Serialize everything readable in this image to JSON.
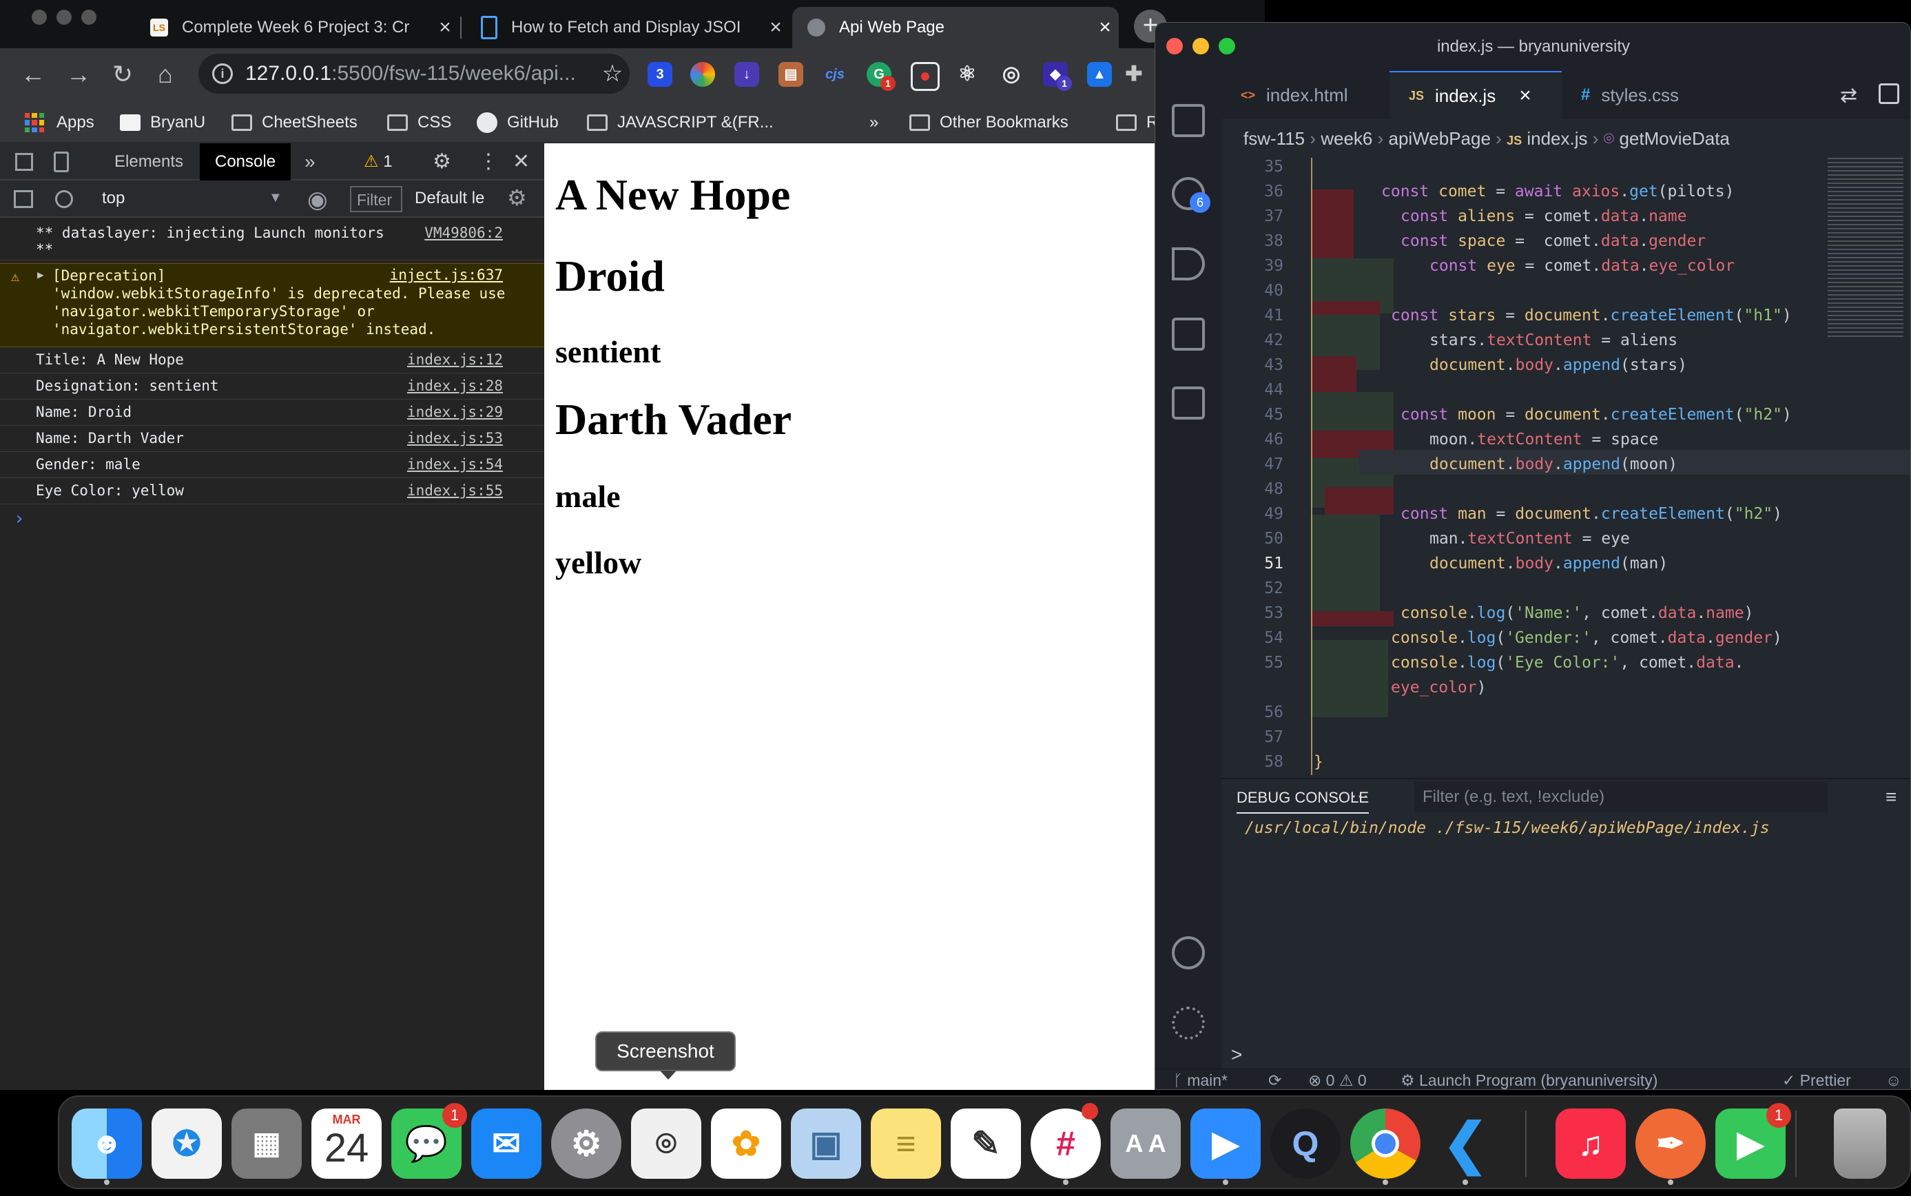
{
  "chrome": {
    "tabs": [
      {
        "title": "Complete Week 6 Project 3: Cr",
        "favicon": "LS"
      },
      {
        "title": "How to Fetch and Display JSOI",
        "favicon": "doc"
      },
      {
        "title": "Api Web Page",
        "favicon": "globe"
      }
    ],
    "url_host": "127.0.0.1",
    "url_path": ":5500/fsw-115/week6/api...",
    "bookmarks": [
      "Apps",
      "BryanU",
      "CheetSheets",
      "CSS",
      "GitHub",
      "JAVASCRIPT &(FR...",
      "»",
      "Other Bookmarks",
      "R"
    ],
    "extension_badges": [
      "1",
      "1"
    ]
  },
  "devtools": {
    "tabs": [
      "Elements",
      "Console",
      "»"
    ],
    "warning_count": "1",
    "context": "top",
    "filter_placeholder": "Filter",
    "levels": "Default le",
    "console": {
      "dataslayer": {
        "text": "** dataslayer: injecting Launch monitors\n**",
        "src": "VM49806:2"
      },
      "warning": {
        "text": "[Deprecation]\n'window.webkitStorageInfo' is deprecated. Please use\n'navigator.webkitTemporaryStorage' or\n'navigator.webkitPersistentStorage' instead.",
        "src": "inject.js:637"
      },
      "logs": [
        {
          "text": "Title: A New Hope",
          "src": "index.js:12"
        },
        {
          "text": "Designation: sentient",
          "src": "index.js:28"
        },
        {
          "text": "Name: Droid",
          "src": "index.js:29"
        },
        {
          "text": "Name: Darth Vader",
          "src": "index.js:53"
        },
        {
          "text": "Gender: male",
          "src": "index.js:54"
        },
        {
          "text": "Eye Color: yellow",
          "src": "index.js:55"
        }
      ],
      "prompt": "›"
    }
  },
  "page": {
    "headings": [
      "A New Hope",
      "Droid",
      "sentient",
      "Darth Vader",
      "male",
      "yellow"
    ]
  },
  "vscode": {
    "title": "index.js — bryanuniversity",
    "tabs": [
      {
        "label": "index.html",
        "icon": "<>"
      },
      {
        "label": "index.js",
        "icon": "JS"
      },
      {
        "label": "styles.css",
        "icon": "#"
      }
    ],
    "breadcrumbs": [
      "fsw-115",
      "week6",
      "apiWebPage",
      "index.js",
      "getMovieData"
    ],
    "scm_badge": "6",
    "line_numbers": [
      "35",
      "36",
      "37",
      "38",
      "39",
      "40",
      "41",
      "42",
      "43",
      "44",
      "45",
      "46",
      "47",
      "48",
      "49",
      "50",
      "51",
      "52",
      "53",
      "54",
      "55",
      "",
      "56",
      "57",
      "58"
    ],
    "current_line": "51",
    "panel": {
      "tab": "DEBUG CONSOLE",
      "more": "···",
      "filter_placeholder": "Filter (e.g. text, !exclude)",
      "output": "/usr/local/bin/node ./fsw-115/week6/apiWebPage/index.js",
      "prompt": ">"
    },
    "status": {
      "branch": "main*",
      "problems": "0",
      "warnings": "0",
      "launch": "Launch Program (bryanuniversity)",
      "formatter": "Prettier"
    }
  },
  "tooltip": "Screenshot",
  "dock": {
    "calendar_month": "MAR",
    "calendar_day": "24",
    "apps": [
      "finder",
      "safari",
      "launchpad",
      "calendar",
      "messages",
      "mail",
      "system-preferences",
      "screenshot",
      "photos",
      "preview",
      "notes",
      "textedit",
      "slack",
      "font-book",
      "zoom",
      "quicktime",
      "chrome",
      "vscode",
      "music",
      "sketch-app",
      "facetime",
      "trash"
    ],
    "badges": {
      "messages": "1",
      "facetime": "1"
    }
  }
}
